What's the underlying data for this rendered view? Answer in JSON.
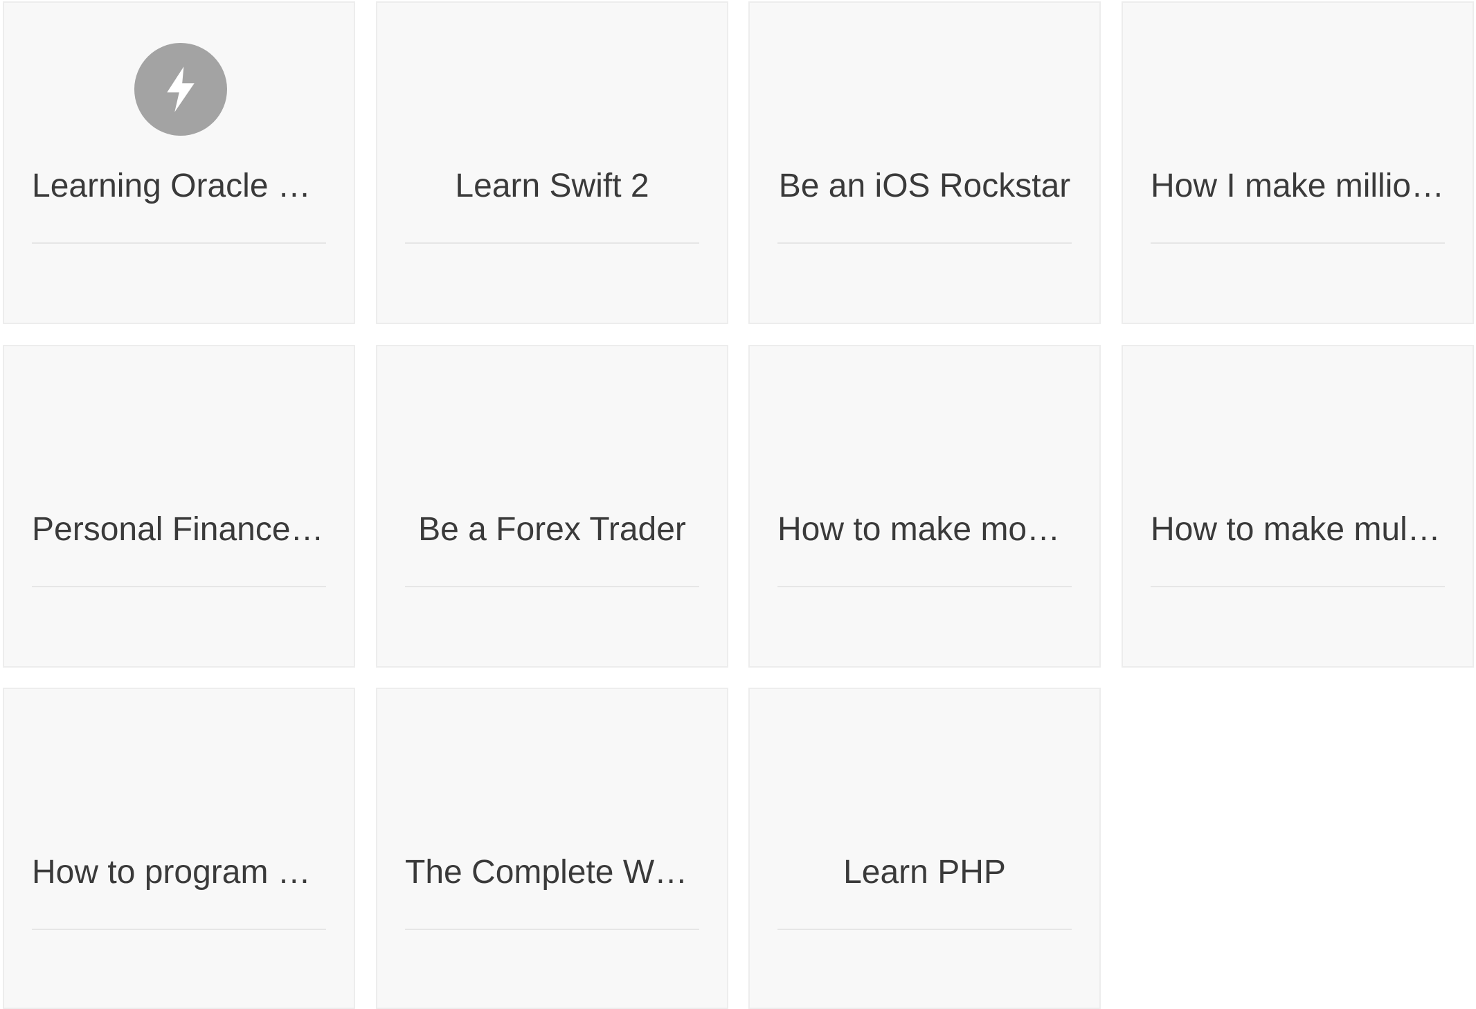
{
  "courses": [
    {
      "title": "Learning Oracle …",
      "align": "left",
      "icon": "lightning-bolt-icon"
    },
    {
      "title": "Learn Swift 2",
      "align": "center"
    },
    {
      "title": "Be an iOS Rockstar",
      "align": "center"
    },
    {
      "title": "How I make millio…",
      "align": "left"
    },
    {
      "title": "Personal Finance…",
      "align": "left"
    },
    {
      "title": "Be a Forex Trader",
      "align": "center"
    },
    {
      "title": "How to make mo…",
      "align": "left"
    },
    {
      "title": "How to make mul…",
      "align": "left"
    },
    {
      "title": "How to program …",
      "align": "left"
    },
    {
      "title": "The Complete W…",
      "align": "left"
    },
    {
      "title": "Learn PHP",
      "align": "center"
    }
  ],
  "colors": {
    "card_background": "#f8f8f8",
    "card_border": "#ededed",
    "badge": "#a3a3a3",
    "text": "#3a3a3a"
  }
}
